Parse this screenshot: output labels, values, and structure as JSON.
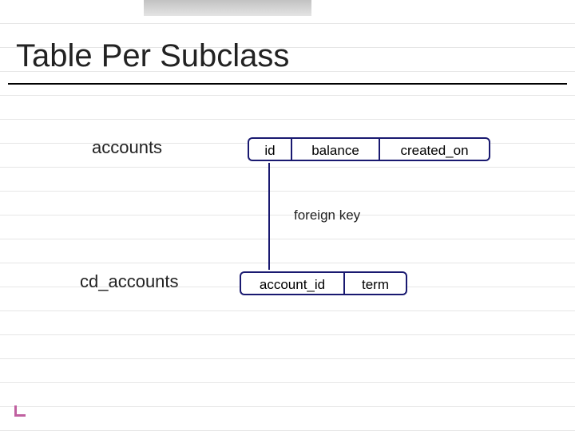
{
  "title": "Table Per Subclass",
  "tables": {
    "accounts": {
      "label": "accounts",
      "columns": [
        "id",
        "balance",
        "created_on"
      ]
    },
    "cd_accounts": {
      "label": "cd_accounts",
      "columns": [
        "account_id",
        "term"
      ]
    }
  },
  "relation": {
    "label": "foreign key",
    "from": "cd_accounts.account_id",
    "to": "accounts.id"
  },
  "colors": {
    "box_border": "#191970",
    "accent": "#c060a0"
  }
}
